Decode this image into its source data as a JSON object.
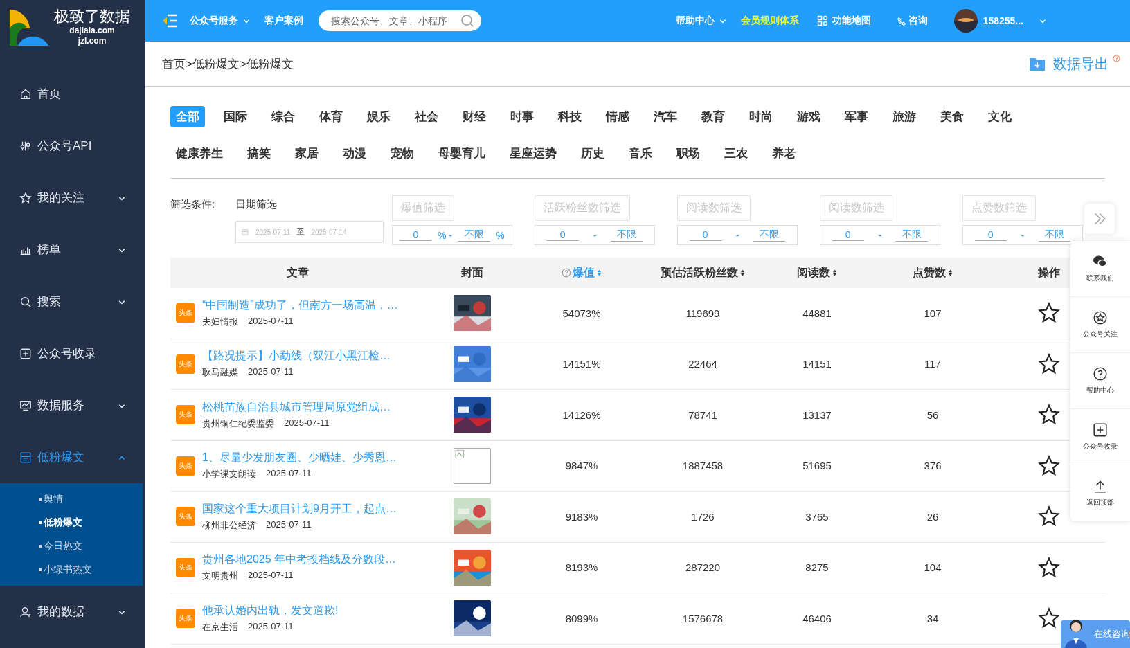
{
  "logo": {
    "name": "极致了数据",
    "domain_1": "dajiala.com",
    "domain_2": "jzl.com"
  },
  "sidebar": {
    "items": [
      {
        "label": "首页",
        "expandable": false,
        "selected": false
      },
      {
        "label": "公众号API",
        "expandable": false,
        "selected": false
      },
      {
        "label": "我的关注",
        "expandable": true,
        "expanded": false,
        "selected": false
      },
      {
        "label": "榜单",
        "expandable": true,
        "expanded": false,
        "selected": false
      },
      {
        "label": "搜索",
        "expandable": true,
        "expanded": false,
        "selected": false
      },
      {
        "label": "公众号收录",
        "expandable": false,
        "selected": false
      },
      {
        "label": "数据服务",
        "expandable": true,
        "expanded": false,
        "selected": false
      },
      {
        "label": "低粉爆文",
        "expandable": true,
        "expanded": true,
        "selected": true,
        "children": [
          {
            "label": "舆情",
            "selected": false
          },
          {
            "label": "低粉爆文",
            "selected": true
          },
          {
            "label": "今日热文",
            "selected": false
          },
          {
            "label": "小绿书热文",
            "selected": false
          }
        ]
      },
      {
        "label": "我的数据",
        "expandable": true,
        "expanded": false,
        "selected": false
      }
    ]
  },
  "topbar": {
    "nav": [
      {
        "label": "公众号服务",
        "dropdown": true
      },
      {
        "label": "客户案例",
        "dropdown": false
      }
    ],
    "search": {
      "placeholder": "搜索公众号、文章、小程序"
    },
    "help": "帮助中心",
    "membership": "会员规则体系",
    "feature_map": "功能地图",
    "consult": "咨询",
    "user": "158255..."
  },
  "breadcrumb": "首页>低粉爆文>低粉爆文",
  "export": "数据导出",
  "categories": [
    {
      "label": "全部",
      "selected": true
    },
    {
      "label": "国际",
      "selected": false
    },
    {
      "label": "综合",
      "selected": false
    },
    {
      "label": "体育",
      "selected": false
    },
    {
      "label": "娱乐",
      "selected": false
    },
    {
      "label": "社会",
      "selected": false
    },
    {
      "label": "财经",
      "selected": false
    },
    {
      "label": "时事",
      "selected": false
    },
    {
      "label": "科技",
      "selected": false
    },
    {
      "label": "情感",
      "selected": false
    },
    {
      "label": "汽车",
      "selected": false
    },
    {
      "label": "教育",
      "selected": false
    },
    {
      "label": "时尚",
      "selected": false
    },
    {
      "label": "游戏",
      "selected": false
    },
    {
      "label": "军事",
      "selected": false
    },
    {
      "label": "旅游",
      "selected": false
    },
    {
      "label": "美食",
      "selected": false
    },
    {
      "label": "文化",
      "selected": false
    },
    {
      "label": "健康养生",
      "selected": false
    },
    {
      "label": "搞笑",
      "selected": false
    },
    {
      "label": "家居",
      "selected": false
    },
    {
      "label": "动漫",
      "selected": false
    },
    {
      "label": "宠物",
      "selected": false
    },
    {
      "label": "母婴育儿",
      "selected": false
    },
    {
      "label": "星座运势",
      "selected": false
    },
    {
      "label": "历史",
      "selected": false
    },
    {
      "label": "音乐",
      "selected": false
    },
    {
      "label": "职场",
      "selected": false
    },
    {
      "label": "三农",
      "selected": false
    },
    {
      "label": "养老",
      "selected": false
    }
  ],
  "filters": {
    "label": "筛选条件:",
    "date": {
      "label": "日期筛选",
      "from": "2025-07-11",
      "sep": "至",
      "to": "2025-07-14"
    },
    "ranges": [
      {
        "label": "爆值筛选",
        "min": "0",
        "sep": "% -",
        "max": "不限",
        "unit": "%"
      },
      {
        "label": "活跃粉丝数筛选",
        "min": "0",
        "sep": "-",
        "max": "不限"
      },
      {
        "label": "阅读数筛选",
        "min": "0",
        "sep": "-",
        "max": "不限"
      },
      {
        "label": "阅读数筛选",
        "min": "0",
        "sep": "-",
        "max": "不限"
      },
      {
        "label": "点赞数筛选",
        "min": "0",
        "sep": "-",
        "max": "不限"
      }
    ]
  },
  "table": {
    "columns": [
      {
        "label": "文章",
        "sortable": false,
        "active": false,
        "help": false
      },
      {
        "label": "封面",
        "sortable": false,
        "active": false,
        "help": false
      },
      {
        "label": "爆值",
        "sortable": true,
        "active": true,
        "help": true
      },
      {
        "label": "预估活跃粉丝数",
        "sortable": true,
        "active": false,
        "help": false
      },
      {
        "label": "阅读数",
        "sortable": true,
        "active": false,
        "help": false
      },
      {
        "label": "点赞数",
        "sortable": true,
        "active": false,
        "help": false
      },
      {
        "label": "操作",
        "sortable": false,
        "active": false,
        "help": false
      }
    ],
    "rows": [
      {
        "source": "头条",
        "title": "“中国制造”成功了，但南方一场高温，…",
        "account": "夫妇情报",
        "date": "2025-07-11",
        "burst": "54073%",
        "fans": "119699",
        "reads": "44881",
        "likes": "107",
        "favorited": false
      },
      {
        "source": "头条",
        "title": "【路况提示】小勐线（双江小黑江检…",
        "account": "耿马融媒",
        "date": "2025-07-11",
        "burst": "14151%",
        "fans": "22464",
        "reads": "14151",
        "likes": "117",
        "favorited": false
      },
      {
        "source": "头条",
        "title": "松桃苗族自治县城市管理局原党组成…",
        "account": "贵州铜仁纪委监委",
        "date": "2025-07-11",
        "burst": "14126%",
        "fans": "78741",
        "reads": "13137",
        "likes": "56",
        "favorited": false
      },
      {
        "source": "头条",
        "title": "1、尽量少发朋友圈、少晒娃、少秀恩…",
        "account": "小学课文朗读",
        "date": "2025-07-11",
        "cover": {
          "kind": "broken"
        },
        "burst": "9847%",
        "fans": "1887458",
        "reads": "51695",
        "likes": "376",
        "favorited": false
      },
      {
        "source": "头条",
        "title": "国家这个重大项目计划9月开工，起点…",
        "account": "柳州非公经济",
        "date": "2025-07-11",
        "burst": "9183%",
        "fans": "1726",
        "reads": "3765",
        "likes": "26",
        "favorited": false
      },
      {
        "source": "头条",
        "title": "贵州各地2025 年中考投档线及分数段…",
        "account": "文明贵州",
        "date": "2025-07-11",
        "burst": "8193%",
        "fans": "287220",
        "reads": "8275",
        "likes": "104",
        "favorited": false
      },
      {
        "source": "头条",
        "title": "他承认婚内出轨，发文道歉!",
        "account": "在京生活",
        "date": "2025-07-11",
        "burst": "8099%",
        "fans": "1576678",
        "reads": "46406",
        "likes": "34",
        "favorited": false
      }
    ]
  },
  "float_bar": [
    "联系我们",
    "公众号关注",
    "帮助中心",
    "公众号收录",
    "返回顶部"
  ],
  "online_consult": "在线咨询"
}
